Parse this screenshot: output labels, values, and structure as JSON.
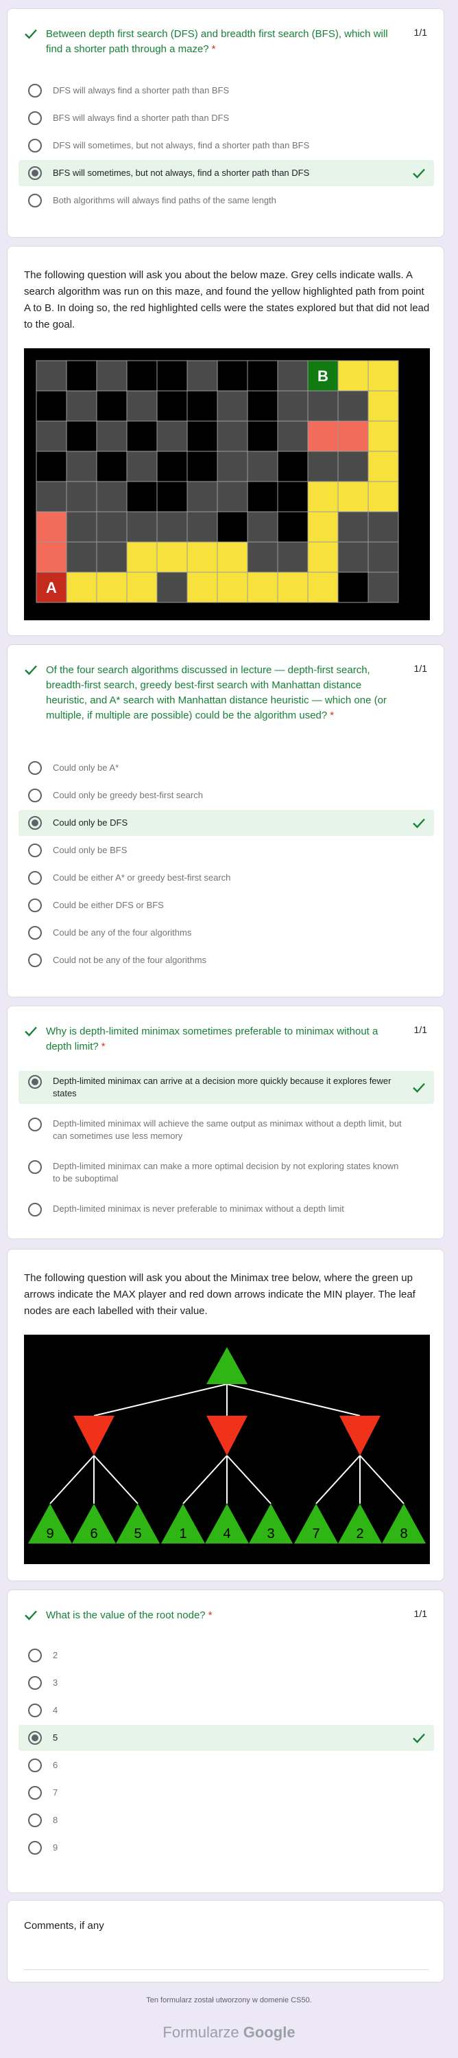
{
  "q1": {
    "title": "Between depth first search (DFS) and breadth first search (BFS), which will find a shorter path through a maze?",
    "required_mark": "*",
    "score": "1/1",
    "options": [
      "DFS will always find a shorter path than BFS",
      "BFS will always find a shorter path than DFS",
      "DFS will sometimes, but not always, find a shorter path than BFS",
      "BFS will sometimes, but not always, find a shorter path than DFS",
      "Both algorithms will always find paths of the same length"
    ],
    "selected": 3
  },
  "maze_section": {
    "description": "The following question will ask you about the below maze. Grey cells indicate walls. A search algorithm was run on this maze, and found the yellow highlighted path from point A to B. In doing so, the red highlighted cells were the states explored but that did not lead to the goal.",
    "label_a": "A",
    "label_b": "B",
    "colors": {
      "wall": "#4a4a4a",
      "open": "#000000",
      "path": "#f8e13c",
      "explored": "#f26b5b",
      "start": "#c42b1c",
      "goal": "#0f7b10"
    }
  },
  "q2": {
    "title": "Of the four search algorithms discussed in lecture — depth-first search, breadth-first search, greedy best-first search with Manhattan distance heuristic, and A* search with Manhattan distance heuristic — which one (or multiple, if multiple are possible) could be the algorithm used?",
    "required_mark": "*",
    "score": "1/1",
    "options": [
      "Could only be A*",
      "Could only be greedy best-first search",
      "Could only be DFS",
      "Could only be BFS",
      "Could be either A* or greedy best-first search",
      "Could be either DFS or BFS",
      "Could be any of the four algorithms",
      "Could not be any of the four algorithms"
    ],
    "selected": 2
  },
  "q3": {
    "title": "Why is depth-limited minimax sometimes preferable to minimax without a depth limit?",
    "required_mark": "*",
    "score": "1/1",
    "options": [
      "Depth-limited minimax can arrive at a decision more quickly because it explores fewer states",
      "Depth-limited minimax will achieve the same output as minimax without a depth limit, but can sometimes use less memory",
      "Depth-limited minimax can make a more optimal decision by not exploring states known to be suboptimal",
      "Depth-limited minimax is never preferable to minimax without a depth limit"
    ],
    "selected": 0
  },
  "tree_section": {
    "description": "The following question will ask you about the Minimax tree below, where the green up arrows indicate the MAX player and red down arrows indicate the MIN player. The leaf nodes are each labelled with their value.",
    "leaf_values": [
      "9",
      "6",
      "5",
      "1",
      "4",
      "3",
      "7",
      "2",
      "8"
    ],
    "colors": {
      "max": "#2fb514",
      "min": "#f0321a",
      "background": "#000000"
    }
  },
  "q4": {
    "title": "What is the value of the root node?",
    "required_mark": "*",
    "score": "1/1",
    "options": [
      "2",
      "3",
      "4",
      "5",
      "6",
      "7",
      "8",
      "9"
    ],
    "selected": 3
  },
  "comments": {
    "label": "Comments, if any"
  },
  "footer": {
    "note": "Ten formularz został utworzony w domenie CS50.",
    "brand_light": "Formularze",
    "brand_bold": "Google"
  }
}
